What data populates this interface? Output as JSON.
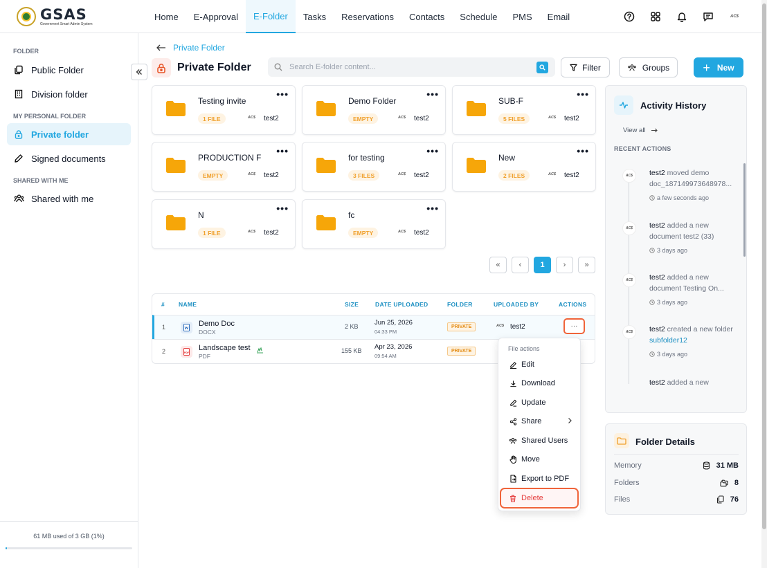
{
  "app": {
    "logo_title": "GSAS",
    "logo_subtitle": "Government Smart Admin System"
  },
  "nav": {
    "items": [
      "Home",
      "E-Approval",
      "E-Folder",
      "Tasks",
      "Reservations",
      "Contacts",
      "Schedule",
      "PMS",
      "Email"
    ],
    "active": "E-Folder",
    "avatar": "AC$"
  },
  "sidebar": {
    "section_folder": "FOLDER",
    "public_folder": "Public Folder",
    "division_folder": "Division folder",
    "section_personal": "MY PERSONAL FOLDER",
    "private_folder": "Private folder",
    "signed_documents": "Signed documents",
    "section_shared": "SHARED WITH ME",
    "shared_with_me": "Shared with me",
    "storage_text": "61 MB used of 3 GB (1%)",
    "storage_fraction": 0.01
  },
  "page": {
    "breadcrumb": "Private Folder",
    "title": "Private Folder",
    "search_placeholder": "Search E-folder content...",
    "filter_label": "Filter",
    "groups_label": "Groups",
    "new_label": "New"
  },
  "folders": [
    {
      "name": "Testing invite",
      "badge": "1 FILE",
      "avatar": "AC$",
      "user": "test2"
    },
    {
      "name": "Demo Folder",
      "badge": "EMPTY",
      "avatar": "AC$",
      "user": "test2"
    },
    {
      "name": "SUB-F",
      "badge": "5 FILES",
      "avatar": "AC$",
      "user": "test2"
    },
    {
      "name": "PRODUCTION F",
      "badge": "EMPTY",
      "avatar": "AC$",
      "user": "test2"
    },
    {
      "name": "for testing",
      "badge": "3 FILES",
      "avatar": "AC$",
      "user": "test2"
    },
    {
      "name": "New",
      "badge": "2 FILES",
      "avatar": "AC$",
      "user": "test2"
    },
    {
      "name": "N",
      "badge": "1 FILE",
      "avatar": "AC$",
      "user": "test2"
    },
    {
      "name": "fc",
      "badge": "EMPTY",
      "avatar": "AC$",
      "user": "test2"
    }
  ],
  "pagination": {
    "current": "1",
    "first": "«",
    "prev": "‹",
    "next": "›",
    "last": "»"
  },
  "table": {
    "headers": {
      "num": "#",
      "name": "NAME",
      "size": "SIZE",
      "date": "DATE UPLOADED",
      "folder": "FOLDER",
      "uploaded_by": "UPLOADED BY",
      "actions": "ACTIONS"
    },
    "rows": [
      {
        "num": "1",
        "name": "Demo Doc",
        "type": "DOCX",
        "size": "2 KB",
        "date": "Jun 25, 2026",
        "time": "04:33 PM",
        "folder": "PRIVATE",
        "avatar": "AC$",
        "user": "test2"
      },
      {
        "num": "2",
        "name": "Landscape test",
        "type": "PDF",
        "size": "155 KB",
        "date": "Apr 23, 2026",
        "time": "09:54 AM",
        "folder": "PRIVATE"
      }
    ]
  },
  "context_menu": {
    "header": "File actions",
    "items": [
      "Edit",
      "Download",
      "Update",
      "Share",
      "Shared Users",
      "Move",
      "Export to PDF",
      "Delete"
    ]
  },
  "activity": {
    "title": "Activity History",
    "view_all": "View all",
    "recent_label": "RECENT ACTIONS",
    "items": [
      {
        "user": "test2",
        "action": " moved demo doc_187149973648978...",
        "link": "",
        "time": "a few seconds ago",
        "avatar": "AC$"
      },
      {
        "user": "test2",
        "action": " added a new document  test2 (33)",
        "link": "",
        "time": "3 days ago",
        "avatar": "AC$"
      },
      {
        "user": "test2",
        "action": " added a new document  Testing On...",
        "link": "",
        "time": "3 days ago",
        "avatar": "AC$"
      },
      {
        "user": "test2",
        "action": " created a new folder ",
        "link": "subfolder12",
        "time": "3 days ago",
        "avatar": "AC$"
      },
      {
        "user": "test2",
        "action": " added a new",
        "link": "",
        "time": "",
        "avatar": ""
      }
    ]
  },
  "details": {
    "title": "Folder Details",
    "memory_label": "Memory",
    "memory_value": "31 MB",
    "folders_label": "Folders",
    "folders_value": "8",
    "files_label": "Files",
    "files_value": "76"
  },
  "colors": {
    "accent": "#22a7e0",
    "folder": "#f6a609",
    "danger": "#e53e3e",
    "highlight": "#f0643a"
  }
}
